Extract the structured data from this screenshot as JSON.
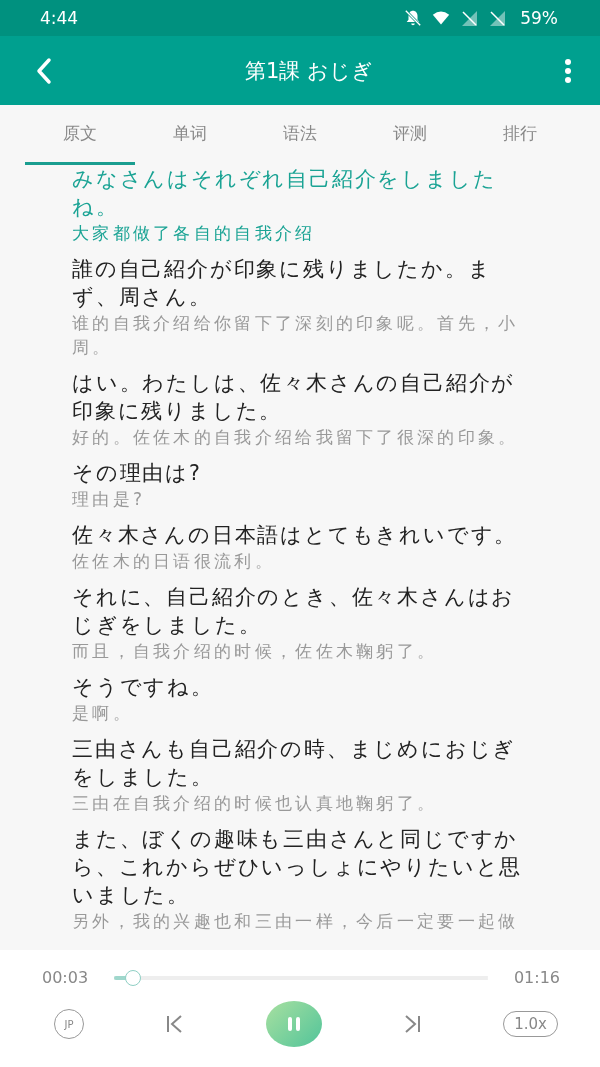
{
  "status_bar": {
    "time": "4:44",
    "battery": "59%"
  },
  "app_bar": {
    "title": "第1課 おじぎ"
  },
  "tabs": [
    {
      "label": "原文",
      "selected": true
    },
    {
      "label": "单词",
      "selected": false
    },
    {
      "label": "语法",
      "selected": false
    },
    {
      "label": "评测",
      "selected": false
    },
    {
      "label": "排行",
      "selected": false
    }
  ],
  "sentences": [
    {
      "japanese": "みなさんはそれぞれ自己紹介をしましたね。",
      "chinese": "大家都做了各自的自我介绍",
      "selected": true
    },
    {
      "japanese": "誰の自己紹介が印象に残りましたか。まず、周さん。",
      "chinese": "谁的自我介绍给你留下了深刻的印象呢。首先，小周。",
      "selected": false
    },
    {
      "japanese": "はい。わたしは、佐々木さんの自己紹介が印象に残りました。",
      "chinese": "好的。佐佐木的自我介绍给我留下了很深的印象。",
      "selected": false
    },
    {
      "japanese": "その理由は?",
      "chinese": "理由是?",
      "selected": false
    },
    {
      "japanese": "佐々木さんの日本語はとてもきれいです。",
      "chinese": "佐佐木的日语很流利。",
      "selected": false
    },
    {
      "japanese": "それに、自己紹介のとき、佐々木さんはおじぎをしました。",
      "chinese": "而且，自我介绍的时候，佐佐木鞠躬了。",
      "selected": false
    },
    {
      "japanese": "そうですね。",
      "chinese": "是啊。",
      "selected": false
    },
    {
      "japanese": "三由さんも自己紹介の時、まじめにおじぎをしました。",
      "chinese": "三由在自我介绍的时候也认真地鞠躬了。",
      "selected": false
    },
    {
      "japanese": "また、ぼくの趣味も三由さんと同じですから、これからぜひいっしょにやりたいと思いました。",
      "chinese": "另外，我的兴趣也和三由一样，今后一定要一起做",
      "selected": false
    }
  ],
  "player": {
    "elapsed": "00:03",
    "total": "01:16",
    "level": 0.04,
    "language": "JP",
    "playing": true,
    "speed": "1.0x"
  }
}
